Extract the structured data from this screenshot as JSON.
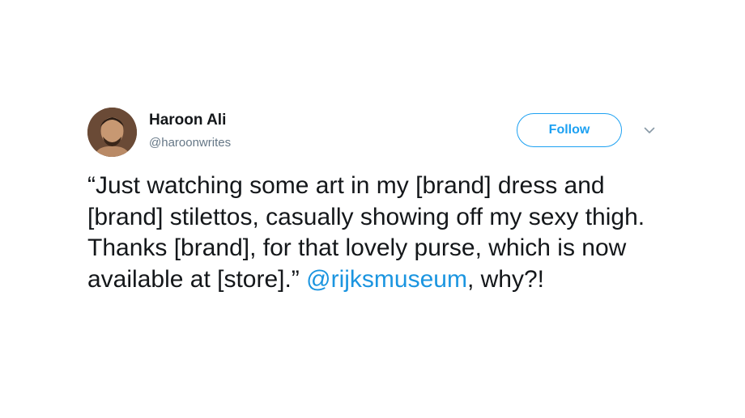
{
  "author": {
    "display_name": "Haroon Ali",
    "handle": "@haroonwrites"
  },
  "actions": {
    "follow_label": "Follow",
    "more_icon": "chevron-down-icon"
  },
  "tweet": {
    "body": "“Just watching some art in my [brand] dress and [brand] stilettos, casually showing off my sexy thigh. Thanks [brand], for that lovely purse, which is now available at [store].”",
    "mention": "@rijksmuseum",
    "suffix": ", why?!"
  },
  "colors": {
    "accent": "#1da1f2",
    "mention": "#1b95e0",
    "text": "#14171a",
    "secondary": "#657786"
  }
}
